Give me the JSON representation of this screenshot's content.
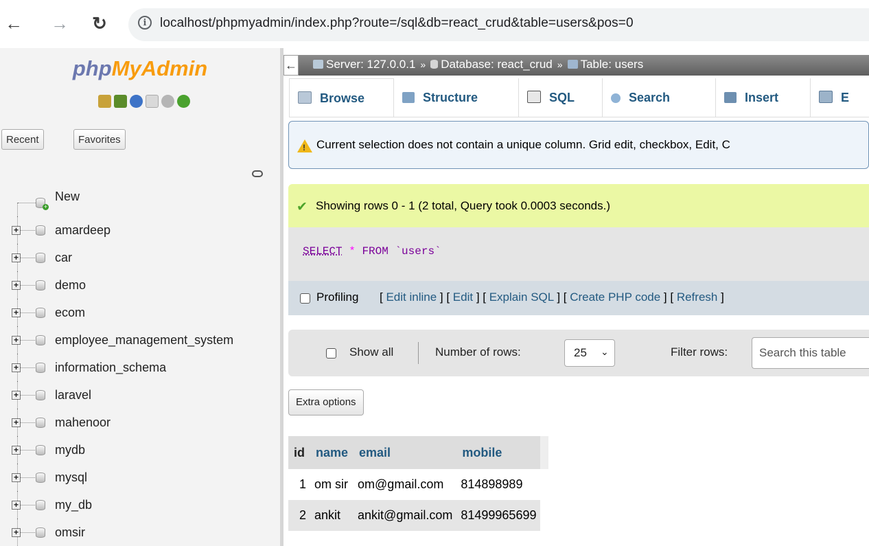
{
  "browser": {
    "back_icon": "arrow-left-icon",
    "forward_icon": "arrow-right-icon",
    "reload_icon": "reload-icon",
    "url": "localhost/phpmyadmin/index.php?route=/sql&db=react_crud&table=users&pos=0"
  },
  "sidebar": {
    "logo_php": "php",
    "logo_myadmin": "MyAdmin",
    "recent_label": "Recent",
    "favorites_label": "Favorites",
    "new_label": "New",
    "databases": [
      "amardeep",
      "car",
      "demo",
      "ecom",
      "employee_management_system",
      "information_schema",
      "laravel",
      "mahenoor",
      "mydb",
      "mysql",
      "my_db",
      "omsir"
    ]
  },
  "breadcrumb": {
    "collapse_glyph": "←",
    "server": "Server: 127.0.0.1",
    "database": "Database: react_crud",
    "table": "Table: users",
    "separator": "»"
  },
  "tabs": [
    {
      "label": "Browse",
      "icon": "browse-icon"
    },
    {
      "label": "Structure",
      "icon": "structure-icon"
    },
    {
      "label": "SQL",
      "icon": "sql-icon"
    },
    {
      "label": "Search",
      "icon": "search-icon"
    },
    {
      "label": "Insert",
      "icon": "insert-icon"
    },
    {
      "label": "E",
      "icon": "export-icon"
    }
  ],
  "notice": {
    "text": "Current selection does not contain a unique column. Grid edit, checkbox, Edit, C"
  },
  "success": {
    "text": "Showing rows 0 - 1 (2 total, Query took 0.0003 seconds.)"
  },
  "sql": {
    "select": "SELECT",
    "star": "*",
    "from": "FROM",
    "table": "`users`"
  },
  "profiling": {
    "label": "Profiling",
    "links": [
      "Edit inline",
      "Edit",
      "Explain SQL",
      "Create PHP code",
      "Refresh"
    ]
  },
  "rows_nav": {
    "show_all": "Show all",
    "number_of_rows_label": "Number of rows:",
    "number_of_rows_value": "25",
    "caret": "⌄",
    "filter_label": "Filter rows:",
    "filter_placeholder": "Search this table"
  },
  "extra_options": "Extra options",
  "results": {
    "columns": [
      "id",
      "name",
      "email",
      "mobile"
    ],
    "rows": [
      [
        "1",
        "om sir",
        "om@gmail.com",
        "814898989"
      ],
      [
        "2",
        "ankit",
        "ankit@gmail.com",
        "81499965699"
      ]
    ]
  },
  "colors": {
    "link": "#235a81",
    "success_bg": "#ebf8a4",
    "notice_bg": "#eef4fa",
    "logo_blue": "#6c78af",
    "logo_orange": "#f89c0e"
  }
}
